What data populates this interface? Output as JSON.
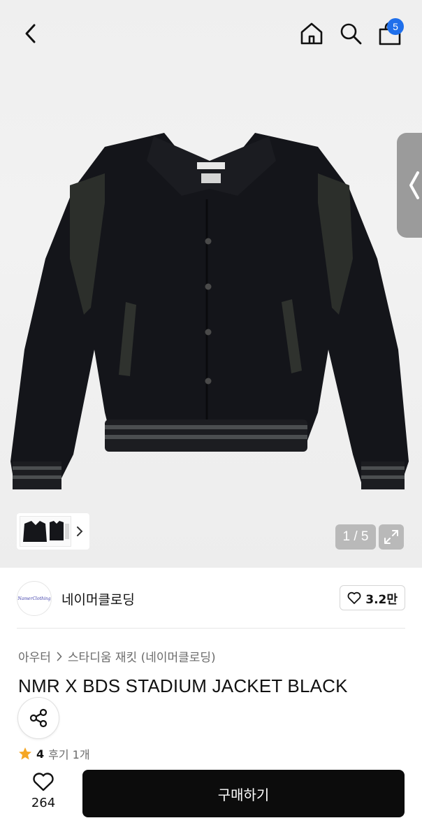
{
  "header": {
    "back_icon": "chevron-left-icon",
    "home_icon": "home-icon",
    "search_icon": "search-icon",
    "bag_icon": "shopping-bag-icon",
    "bag_count": "5",
    "badge_color": "#1f6feb"
  },
  "gallery": {
    "counter": "1 / 5",
    "thumbnail_arrow": "chevron-right-icon",
    "expand_icon": "expand-icon",
    "side_handle_icon": "chevron-left-icon"
  },
  "shop": {
    "logo_text": "NamerClothing",
    "name": "네이머클로딩",
    "likes": "3.2만",
    "like_icon": "heart-icon"
  },
  "product": {
    "breadcrumb": [
      "아우터",
      "스타디움 재킷 (네이머클로딩)"
    ],
    "title": "NMR X BDS STADIUM JACKET BLACK",
    "rating": "4",
    "review_label": "후기 1개",
    "share_icon": "share-icon",
    "star_color": "#f5a623"
  },
  "bottom": {
    "wish_count": "264",
    "buy_label": "구매하기"
  }
}
